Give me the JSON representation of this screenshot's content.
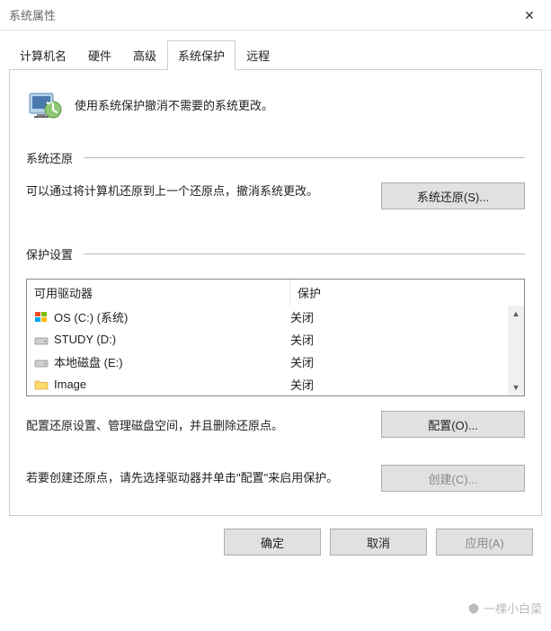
{
  "window": {
    "title": "系统属性"
  },
  "tabs": {
    "computer_name": "计算机名",
    "hardware": "硬件",
    "advanced": "高级",
    "system_protection": "系统保护",
    "remote": "远程"
  },
  "intro": {
    "text": "使用系统保护撤消不需要的系统更改。"
  },
  "restore": {
    "title": "系统还原",
    "text": "可以通过将计算机还原到上一个还原点，撤消系统更改。",
    "button": "系统还原(S)..."
  },
  "protection": {
    "title": "保护设置",
    "headers": {
      "drive": "可用驱动器",
      "status": "保护"
    },
    "drives": [
      {
        "icon": "windows",
        "label": "OS (C:) (系统)",
        "status": "关闭"
      },
      {
        "icon": "disk",
        "label": "STUDY (D:)",
        "status": "关闭"
      },
      {
        "icon": "disk",
        "label": "本地磁盘 (E:)",
        "status": "关闭"
      },
      {
        "icon": "folder",
        "label": "Image",
        "status": "关闭"
      }
    ],
    "config_text": "配置还原设置、管理磁盘空间，并且删除还原点。",
    "config_button": "配置(O)...",
    "create_text": "若要创建还原点，请先选择驱动器并单击\"配置\"来启用保护。",
    "create_button": "创建(C)..."
  },
  "buttons": {
    "ok": "确定",
    "cancel": "取消",
    "apply": "应用(A)"
  },
  "watermark": "一棵小白菜"
}
